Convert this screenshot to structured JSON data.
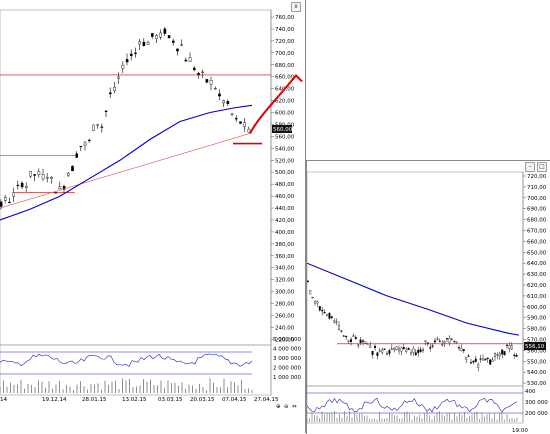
{
  "colors": {
    "candle": "#000000",
    "ma": "#0000cc",
    "trend": "#e05050",
    "level": "#c00000",
    "annotation": "#e00000",
    "osc": "#2020c0",
    "grid": "#cccccc"
  },
  "window_controls": {
    "close_icon": "x",
    "maximize_icon": "square-icon",
    "minimize_icon": "minus-icon"
  },
  "left_chart": {
    "price_axis_ticks": [
      "760,00",
      "740,00",
      "720,00",
      "700,00",
      "680,00",
      "660,00",
      "640,00",
      "620,00",
      "600,00",
      "580,00",
      "560,00",
      "540,00",
      "520,00",
      "500,00",
      "480,00",
      "460,00",
      "440,00",
      "420,00",
      "400,00",
      "380,00",
      "360,00",
      "340,00",
      "320,00",
      "300,00",
      "280,00",
      "260,00",
      "240,00",
      "220,00"
    ],
    "last_price": "560,00",
    "volume_axis_ticks": [
      "5 000 000",
      "4 000 000",
      "3 000 000",
      "2 000 000",
      "1 000 000"
    ],
    "date_labels": [
      "14",
      "19.12.14",
      "28.01.15",
      "13.02.15",
      "03.03.15",
      "20.03.15",
      "07.04.15",
      "27.04.15"
    ]
  },
  "right_chart": {
    "price_axis_ticks": [
      "720,00",
      "710,00",
      "700,00",
      "690,00",
      "680,00",
      "670,00",
      "660,00",
      "650,00",
      "640,00",
      "630,00",
      "620,00",
      "610,00",
      "600,00",
      "590,00",
      "580,00",
      "570,00",
      "560,00",
      "550,00",
      "540,00",
      "530,00"
    ],
    "last_price": "556,10",
    "volume_axis_ticks": [
      "400",
      "300 000",
      "200 000"
    ],
    "time_label": "19:00"
  },
  "chart_data": [
    {
      "type": "line",
      "xlabel": "",
      "ylabel": "",
      "x": [
        "19.12.14",
        "28.01.15",
        "13.02.15",
        "03.03.15",
        "20.03.15",
        "07.04.15",
        "27.04.15"
      ],
      "series": [
        {
          "name": "",
          "values": [
            460,
            600,
            715,
            740,
            650,
            590,
            560
          ]
        }
      ],
      "ylim": [
        220,
        760
      ]
    },
    {
      "type": "line",
      "xlabel": "",
      "ylabel": "",
      "series": [
        {
          "name": "",
          "values": [
            615,
            580,
            565,
            560,
            560,
            565,
            575,
            565,
            550,
            560,
            556
          ]
        }
      ],
      "ylim": [
        530,
        720
      ]
    }
  ]
}
